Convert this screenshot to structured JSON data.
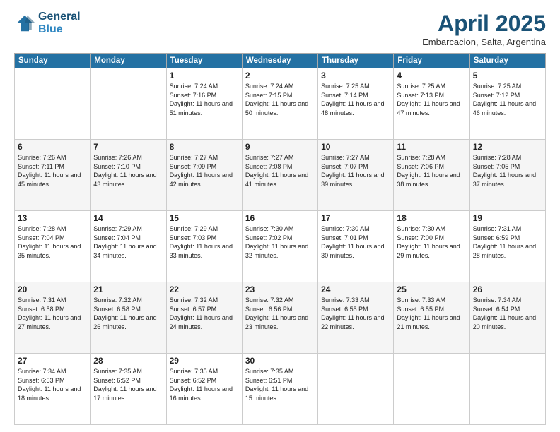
{
  "header": {
    "logo_line1": "General",
    "logo_line2": "Blue",
    "month": "April 2025",
    "location": "Embarcacion, Salta, Argentina"
  },
  "weekdays": [
    "Sunday",
    "Monday",
    "Tuesday",
    "Wednesday",
    "Thursday",
    "Friday",
    "Saturday"
  ],
  "weeks": [
    [
      {
        "day": "",
        "info": ""
      },
      {
        "day": "",
        "info": ""
      },
      {
        "day": "1",
        "info": "Sunrise: 7:24 AM\nSunset: 7:16 PM\nDaylight: 11 hours\nand 51 minutes."
      },
      {
        "day": "2",
        "info": "Sunrise: 7:24 AM\nSunset: 7:15 PM\nDaylight: 11 hours\nand 50 minutes."
      },
      {
        "day": "3",
        "info": "Sunrise: 7:25 AM\nSunset: 7:14 PM\nDaylight: 11 hours\nand 48 minutes."
      },
      {
        "day": "4",
        "info": "Sunrise: 7:25 AM\nSunset: 7:13 PM\nDaylight: 11 hours\nand 47 minutes."
      },
      {
        "day": "5",
        "info": "Sunrise: 7:25 AM\nSunset: 7:12 PM\nDaylight: 11 hours\nand 46 minutes."
      }
    ],
    [
      {
        "day": "6",
        "info": "Sunrise: 7:26 AM\nSunset: 7:11 PM\nDaylight: 11 hours\nand 45 minutes."
      },
      {
        "day": "7",
        "info": "Sunrise: 7:26 AM\nSunset: 7:10 PM\nDaylight: 11 hours\nand 43 minutes."
      },
      {
        "day": "8",
        "info": "Sunrise: 7:27 AM\nSunset: 7:09 PM\nDaylight: 11 hours\nand 42 minutes."
      },
      {
        "day": "9",
        "info": "Sunrise: 7:27 AM\nSunset: 7:08 PM\nDaylight: 11 hours\nand 41 minutes."
      },
      {
        "day": "10",
        "info": "Sunrise: 7:27 AM\nSunset: 7:07 PM\nDaylight: 11 hours\nand 39 minutes."
      },
      {
        "day": "11",
        "info": "Sunrise: 7:28 AM\nSunset: 7:06 PM\nDaylight: 11 hours\nand 38 minutes."
      },
      {
        "day": "12",
        "info": "Sunrise: 7:28 AM\nSunset: 7:05 PM\nDaylight: 11 hours\nand 37 minutes."
      }
    ],
    [
      {
        "day": "13",
        "info": "Sunrise: 7:28 AM\nSunset: 7:04 PM\nDaylight: 11 hours\nand 35 minutes."
      },
      {
        "day": "14",
        "info": "Sunrise: 7:29 AM\nSunset: 7:04 PM\nDaylight: 11 hours\nand 34 minutes."
      },
      {
        "day": "15",
        "info": "Sunrise: 7:29 AM\nSunset: 7:03 PM\nDaylight: 11 hours\nand 33 minutes."
      },
      {
        "day": "16",
        "info": "Sunrise: 7:30 AM\nSunset: 7:02 PM\nDaylight: 11 hours\nand 32 minutes."
      },
      {
        "day": "17",
        "info": "Sunrise: 7:30 AM\nSunset: 7:01 PM\nDaylight: 11 hours\nand 30 minutes."
      },
      {
        "day": "18",
        "info": "Sunrise: 7:30 AM\nSunset: 7:00 PM\nDaylight: 11 hours\nand 29 minutes."
      },
      {
        "day": "19",
        "info": "Sunrise: 7:31 AM\nSunset: 6:59 PM\nDaylight: 11 hours\nand 28 minutes."
      }
    ],
    [
      {
        "day": "20",
        "info": "Sunrise: 7:31 AM\nSunset: 6:58 PM\nDaylight: 11 hours\nand 27 minutes."
      },
      {
        "day": "21",
        "info": "Sunrise: 7:32 AM\nSunset: 6:58 PM\nDaylight: 11 hours\nand 26 minutes."
      },
      {
        "day": "22",
        "info": "Sunrise: 7:32 AM\nSunset: 6:57 PM\nDaylight: 11 hours\nand 24 minutes."
      },
      {
        "day": "23",
        "info": "Sunrise: 7:32 AM\nSunset: 6:56 PM\nDaylight: 11 hours\nand 23 minutes."
      },
      {
        "day": "24",
        "info": "Sunrise: 7:33 AM\nSunset: 6:55 PM\nDaylight: 11 hours\nand 22 minutes."
      },
      {
        "day": "25",
        "info": "Sunrise: 7:33 AM\nSunset: 6:55 PM\nDaylight: 11 hours\nand 21 minutes."
      },
      {
        "day": "26",
        "info": "Sunrise: 7:34 AM\nSunset: 6:54 PM\nDaylight: 11 hours\nand 20 minutes."
      }
    ],
    [
      {
        "day": "27",
        "info": "Sunrise: 7:34 AM\nSunset: 6:53 PM\nDaylight: 11 hours\nand 18 minutes."
      },
      {
        "day": "28",
        "info": "Sunrise: 7:35 AM\nSunset: 6:52 PM\nDaylight: 11 hours\nand 17 minutes."
      },
      {
        "day": "29",
        "info": "Sunrise: 7:35 AM\nSunset: 6:52 PM\nDaylight: 11 hours\nand 16 minutes."
      },
      {
        "day": "30",
        "info": "Sunrise: 7:35 AM\nSunset: 6:51 PM\nDaylight: 11 hours\nand 15 minutes."
      },
      {
        "day": "",
        "info": ""
      },
      {
        "day": "",
        "info": ""
      },
      {
        "day": "",
        "info": ""
      }
    ]
  ]
}
